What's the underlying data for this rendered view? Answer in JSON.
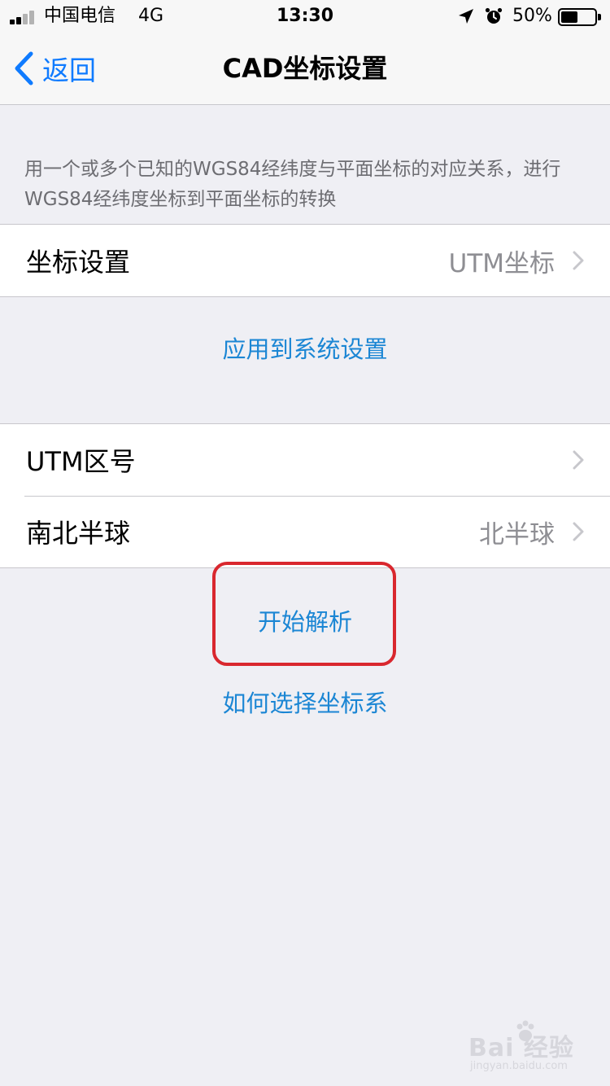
{
  "status_bar": {
    "carrier": "中国电信",
    "network": "4G",
    "time": "13:30",
    "battery_percent": "50%",
    "battery_level": 0.5,
    "icons": [
      "signal-icon",
      "location-arrow-icon",
      "alarm-icon",
      "battery-icon"
    ]
  },
  "nav": {
    "back_label": "返回",
    "title": "CAD坐标设置"
  },
  "description": "用一个或多个已知的WGS84经纬度与平面坐标的对应关系，进行WGS84经纬度坐标到平面坐标的转换",
  "coord_group": {
    "rows": [
      {
        "label": "坐标设置",
        "value": "UTM坐标"
      }
    ]
  },
  "apply_label": "应用到系统设置",
  "utm_group": {
    "rows": [
      {
        "label": "UTM区号",
        "value": ""
      },
      {
        "label": "南北半球",
        "value": "北半球"
      }
    ]
  },
  "start_label": "开始解析",
  "help_label": "如何选择坐标系",
  "watermark": {
    "brand": "Bai  经验",
    "url": "jingyan.baidu.com"
  },
  "colors": {
    "accent": "#0f7bff",
    "link": "#1b86d4",
    "highlight": "#d9272e",
    "background": "#efeff4"
  }
}
